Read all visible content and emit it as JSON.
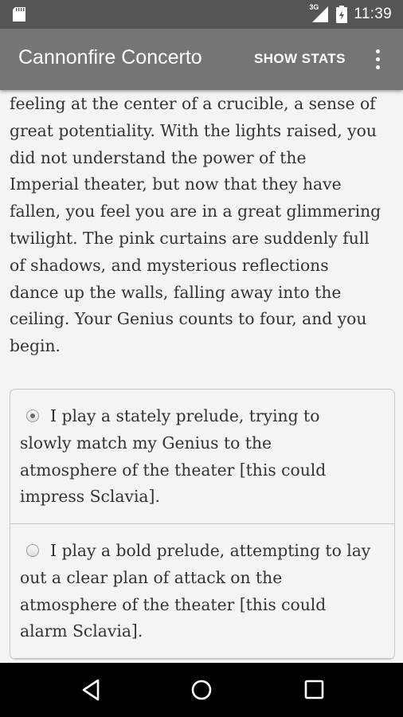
{
  "status_bar": {
    "time": "11:39",
    "network": "3G",
    "icons": [
      "notification-icon",
      "signal-icon",
      "battery-icon"
    ]
  },
  "app_bar": {
    "title": "Cannonfire Concerto",
    "show_stats_label": "SHOW STATS",
    "overflow_icon": "more-vert-icon"
  },
  "story": {
    "lines": [
      "feeling at the center of a crucible, a sense of",
      "great potentiality. With the lights raised, you",
      "did not understand the power of the",
      "Imperial theater, but now that they have",
      "fallen, you feel you are in a great glimmering",
      "twilight. The pink curtains are suddenly full",
      "of shadows, and mysterious reflections",
      "dance up the walls, falling away into the",
      "ceiling. Your Genius counts to four, and you",
      "begin."
    ]
  },
  "choices": [
    {
      "selected": true,
      "lines": [
        "I play a stately prelude, trying to",
        "slowly match my Genius to the",
        "atmosphere of the theater [this could",
        "impress Sclavia]."
      ]
    },
    {
      "selected": false,
      "lines": [
        "I play a bold prelude, attempting to lay",
        "out a clear plan of attack on the",
        "atmosphere of the theater [this could",
        "alarm Sclavia]."
      ]
    }
  ],
  "nav_bar": {
    "buttons": [
      "back-icon",
      "home-icon",
      "recents-icon"
    ]
  }
}
